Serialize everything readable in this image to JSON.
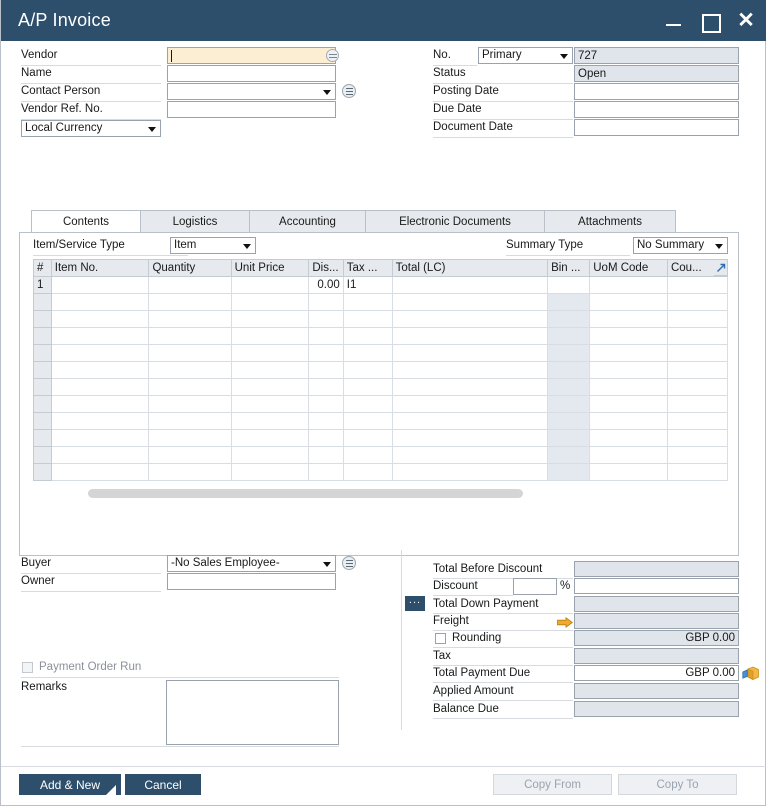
{
  "window": {
    "title": "A/P Invoice",
    "controls": {
      "minimize": "minimize-icon",
      "maximize": "maximize-icon",
      "close": "close-icon"
    },
    "accent_color": "#2d4f6c",
    "active_field_color": "#fbeed3",
    "readonly_field_color": "#dfe5ea"
  },
  "header": {
    "left": {
      "vendor_label": "Vendor",
      "vendor_value": "",
      "name_label": "Name",
      "name_value": "",
      "contact_person_label": "Contact Person",
      "contact_person_value": "",
      "vendor_ref_label": "Vendor Ref. No.",
      "vendor_ref_value": "",
      "currency_value": "Local Currency"
    },
    "right": {
      "no_label": "No.",
      "no_series": "Primary",
      "no_value": "727",
      "status_label": "Status",
      "status_value": "Open",
      "posting_date_label": "Posting Date",
      "posting_date_value": "",
      "due_date_label": "Due Date",
      "due_date_value": "",
      "document_date_label": "Document Date",
      "document_date_value": ""
    }
  },
  "tabs": [
    {
      "label": "Contents",
      "selected": true
    },
    {
      "label": "Logistics",
      "selected": false
    },
    {
      "label": "Accounting",
      "selected": false
    },
    {
      "label": "Electronic Documents",
      "selected": false
    },
    {
      "label": "Attachments",
      "selected": false
    }
  ],
  "contents": {
    "item_service_type_label": "Item/Service Type",
    "item_service_type_value": "Item",
    "summary_type_label": "Summary Type",
    "summary_type_value": "No Summary",
    "grid": {
      "columns": [
        "#",
        "Item No.",
        "Quantity",
        "Unit Price",
        "Dis...",
        "Tax ...",
        "Total (LC)",
        "Bin ...",
        "UoM Code",
        "Cou..."
      ],
      "rows": [
        {
          "num": "1",
          "item_no": "",
          "quantity": "",
          "unit_price": "",
          "discount": "0.00",
          "tax": "I1",
          "total_lc": "",
          "bin": "",
          "uom_code": "",
          "country": ""
        }
      ],
      "empty_row_count": 11
    }
  },
  "footer_left": {
    "buyer_label": "Buyer",
    "buyer_value": "-No Sales Employee-",
    "owner_label": "Owner",
    "owner_value": "",
    "payment_order_run_label": "Payment Order Run",
    "payment_order_run_checked": false,
    "remarks_label": "Remarks",
    "remarks_value": ""
  },
  "totals": {
    "rows": [
      {
        "label": "Total Before Discount",
        "value": "",
        "readonly": true
      },
      {
        "label": "Discount",
        "value": "",
        "percent_label": "%",
        "percent_value": "",
        "readonly": false
      },
      {
        "label": "Total Down Payment",
        "value": "",
        "readonly": true,
        "has_dots_button": true,
        "dots_label": "..."
      },
      {
        "label": "Freight",
        "value": "",
        "readonly": true,
        "has_arrow": true
      },
      {
        "label": "Rounding",
        "value": "GBP 0.00",
        "readonly": true,
        "has_checkbox": true,
        "checked": false
      },
      {
        "label": "Tax",
        "value": "",
        "readonly": true
      },
      {
        "label": "Total Payment Due",
        "value": "GBP 0.00",
        "readonly": false,
        "has_cube_icon": true
      },
      {
        "label": "Applied Amount",
        "value": "",
        "readonly": true
      },
      {
        "label": "Balance Due",
        "value": "",
        "readonly": true
      }
    ]
  },
  "footer_buttons": {
    "add_and_new": "Add & New",
    "cancel": "Cancel",
    "copy_from": "Copy From",
    "copy_to": "Copy To"
  }
}
